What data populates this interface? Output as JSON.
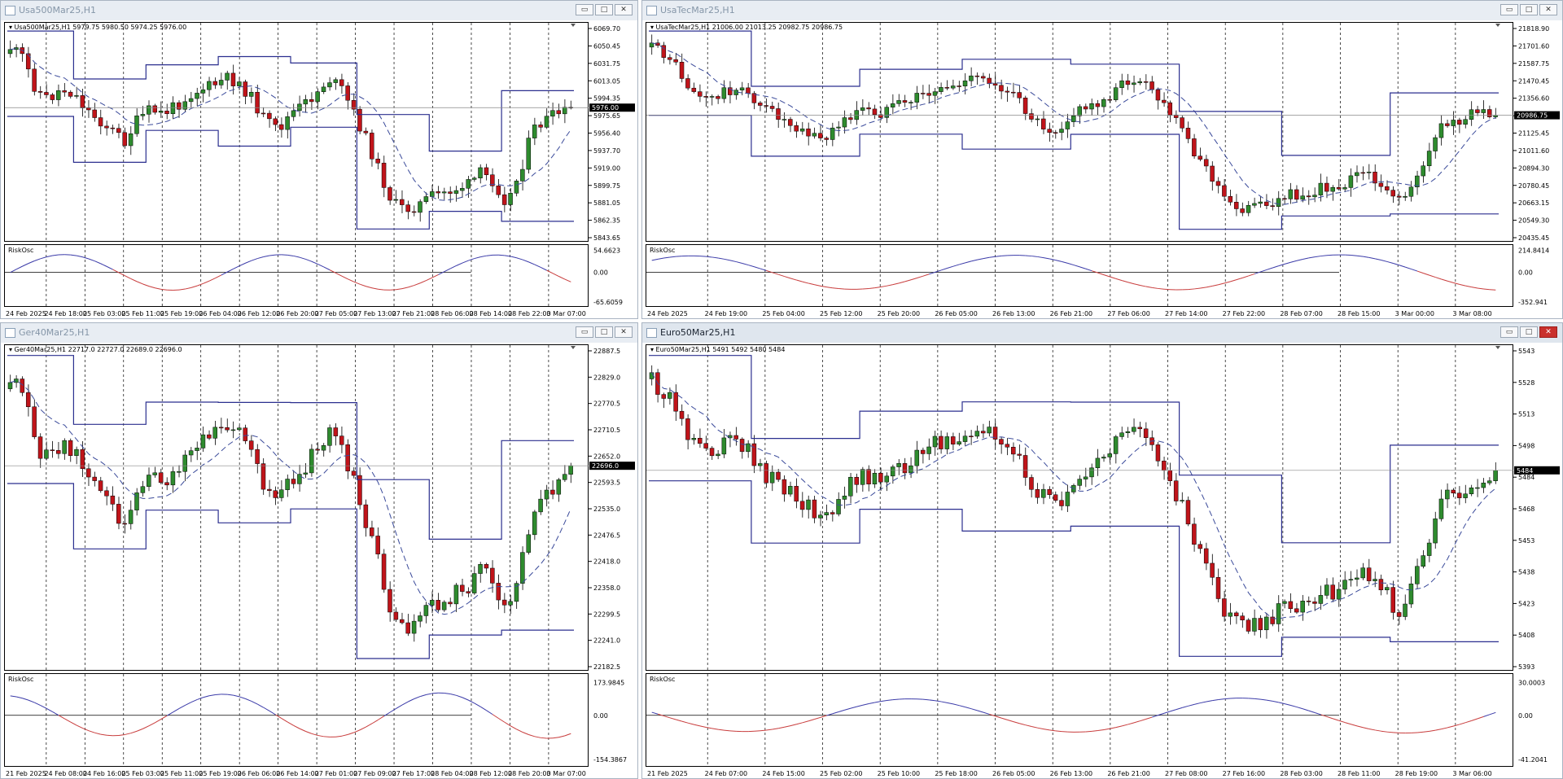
{
  "windows": [
    {
      "id": "usa500",
      "title": "Usa500Mar25,H1",
      "active": false,
      "header": "Usa500Mar25,H1  5979.75 5980.50 5974.25 5976.00",
      "price_labels": [
        "6069.70",
        "6050.45",
        "6031.75",
        "6013.05",
        "5994.35",
        "5975.65",
        "5956.40",
        "5937.70",
        "5919.00",
        "5899.75",
        "5881.05",
        "5862.35",
        "5843.65"
      ],
      "current_price": "5976.00",
      "osc_name": "RiskOsc",
      "osc_labels": [
        "54.6623",
        "0.00",
        "-65.6059"
      ],
      "time_labels": [
        "24 Feb 2025",
        "24 Feb 18:00",
        "25 Feb 03:00",
        "25 Feb 11:00",
        "25 Feb 19:00",
        "26 Feb 04:00",
        "26 Feb 12:00",
        "26 Feb 20:00",
        "27 Feb 05:00",
        "27 Feb 13:00",
        "27 Feb 21:00",
        "28 Feb 06:00",
        "28 Feb 14:00",
        "28 Feb 22:00",
        "3 Mar 07:00"
      ]
    },
    {
      "id": "usatec",
      "title": "UsaTecMar25,H1",
      "active": false,
      "header": "UsaTecMar25,H1  21006.00 21013.25 20982.75 20986.75",
      "price_labels": [
        "21818.90",
        "21701.60",
        "21587.75",
        "21470.45",
        "21356.60",
        "21242.75",
        "21125.45",
        "21011.60",
        "20894.30",
        "20780.45",
        "20663.15",
        "20549.30",
        "20435.45"
      ],
      "current_price": "20986.75",
      "osc_name": "RiskOsc",
      "osc_labels": [
        "214.8414",
        "0.00",
        "-352.941"
      ],
      "time_labels": [
        "24 Feb 2025",
        "24 Feb 19:00",
        "25 Feb 04:00",
        "25 Feb 12:00",
        "25 Feb 20:00",
        "26 Feb 05:00",
        "26 Feb 13:00",
        "26 Feb 21:00",
        "27 Feb 06:00",
        "27 Feb 14:00",
        "27 Feb 22:00",
        "28 Feb 07:00",
        "28 Feb 15:00",
        "3 Mar 00:00",
        "3 Mar 08:00"
      ]
    },
    {
      "id": "ger40",
      "title": "Ger40Mar25,H1",
      "active": false,
      "header": "Ger40Mar25,H1  22717.0 22727.0 22689.0 22696.0",
      "price_labels": [
        "22887.5",
        "22829.0",
        "22770.5",
        "22710.5",
        "22652.0",
        "22593.5",
        "22535.0",
        "22476.5",
        "22418.0",
        "22358.0",
        "22299.5",
        "22241.0",
        "22182.5"
      ],
      "current_price": "22696.0",
      "osc_name": "RiskOsc",
      "osc_labels": [
        "173.9845",
        "0.00",
        "-154.3867"
      ],
      "time_labels": [
        "21 Feb 2025",
        "24 Feb 08:00",
        "24 Feb 16:00",
        "25 Feb 03:00",
        "25 Feb 11:00",
        "25 Feb 19:00",
        "26 Feb 06:00",
        "26 Feb 14:00",
        "27 Feb 01:00",
        "27 Feb 09:00",
        "27 Feb 17:00",
        "28 Feb 04:00",
        "28 Feb 12:00",
        "28 Feb 20:00",
        "3 Mar 07:00"
      ]
    },
    {
      "id": "euro50",
      "title": "Euro50Mar25,H1",
      "active": true,
      "header": "Euro50Mar25,H1  5491 5492 5480 5484",
      "price_labels": [
        "5543",
        "5528",
        "5513",
        "5498",
        "5484",
        "5468",
        "5453",
        "5438",
        "5423",
        "5408",
        "5393"
      ],
      "current_price": "5484",
      "osc_name": "RiskOsc",
      "osc_labels": [
        "30.0003",
        "0.00",
        "-41.2041"
      ],
      "time_labels": [
        "21 Feb 2025",
        "24 Feb 07:00",
        "24 Feb 15:00",
        "25 Feb 02:00",
        "25 Feb 10:00",
        "25 Feb 18:00",
        "26 Feb 05:00",
        "26 Feb 13:00",
        "26 Feb 21:00",
        "27 Feb 08:00",
        "27 Feb 16:00",
        "28 Feb 03:00",
        "28 Feb 11:00",
        "28 Feb 19:00",
        "3 Mar 06:00"
      ]
    }
  ],
  "colors": {
    "bull": "#2e8b2e",
    "bear": "#c0141a",
    "channel": "#2b2f8f",
    "ma": "#3a4a9a",
    "osc_pos": "#3a3aa8",
    "osc_neg": "#c83c3c"
  },
  "icons": {
    "minimize": "minimize-icon",
    "maximize": "maximize-icon",
    "close": "close-icon"
  }
}
